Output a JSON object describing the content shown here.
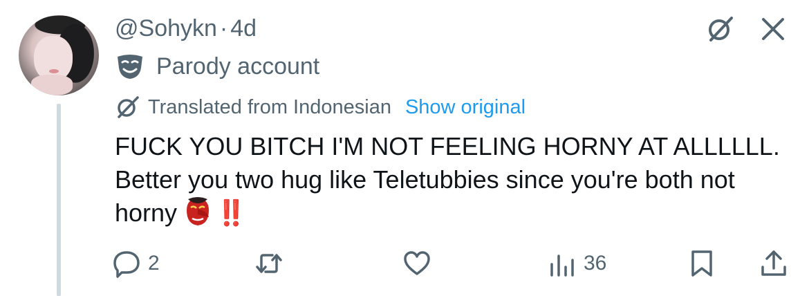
{
  "post": {
    "handle": "@Sohykn",
    "separator": "·",
    "time": "4d",
    "label": "Parody account",
    "translation_note": "Translated from Indonesian",
    "show_original": "Show original",
    "text": "FUCK YOU BITCH I'M NOT FEELING HORNY AT ALLLLLL. Better you two hug like Teletubbies since you're both not horny",
    "trailing_emoji": "goblin-mask",
    "trailing_mark": "‼️"
  },
  "actions": {
    "reply_count": "2",
    "views_count": "36"
  },
  "icons": {
    "grok": "grok-icon",
    "close": "close-icon",
    "parody": "theater-mask-icon",
    "translate": "grok-icon",
    "reply": "reply-icon",
    "repost": "repost-icon",
    "like": "heart-icon",
    "views": "views-icon",
    "bookmark": "bookmark-icon",
    "share": "share-icon"
  },
  "colors": {
    "secondary_text": "#536471",
    "link": "#1d9bf0",
    "text": "#0f1419",
    "thread_line": "#cfd9de",
    "emphasis_red": "#e0282f"
  }
}
